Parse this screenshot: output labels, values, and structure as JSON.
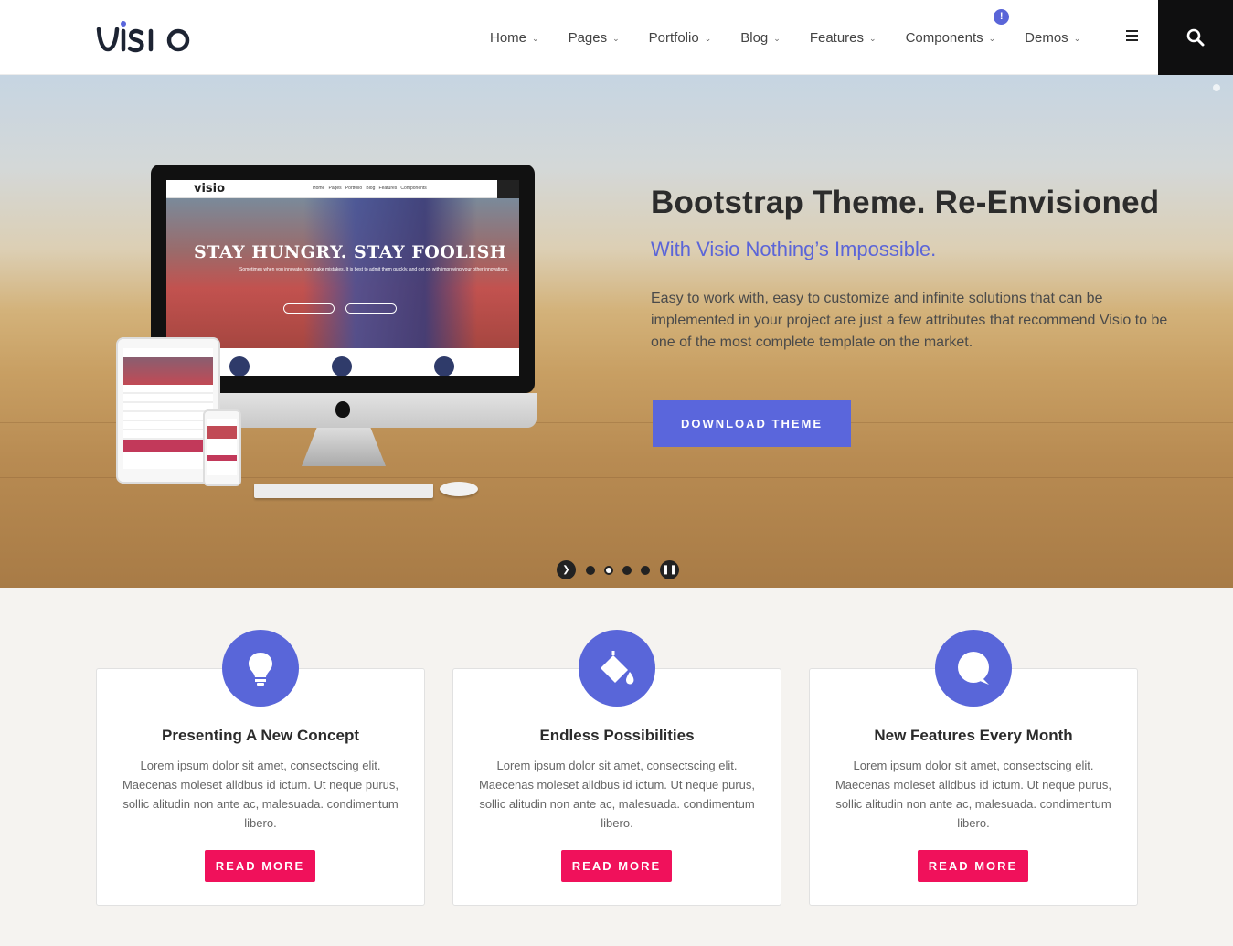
{
  "header": {
    "logo_text": "visio",
    "nav": [
      {
        "label": "Home"
      },
      {
        "label": "Pages"
      },
      {
        "label": "Portfolio"
      },
      {
        "label": "Blog"
      },
      {
        "label": "Features"
      },
      {
        "label": "Components"
      },
      {
        "label": "Demos",
        "badge": "!"
      }
    ],
    "search_icon": "search-icon",
    "menu_icon": "hamburger-icon"
  },
  "hero": {
    "title": "Bootstrap Theme. Re-Envisioned",
    "subtitle": "With Visio Nothing’s Impossible.",
    "description": "Easy to work with, easy to customize and infinite solutions that can be implemented in your project are just a few attributes that recommend Visio to be one of the most complete template on the market.",
    "button": "DOWNLOAD THEME",
    "screen_title": "STAY HUNGRY. STAY FOOLISH",
    "slider": {
      "count": 4,
      "active_index": 1
    }
  },
  "colors": {
    "accent": "#5a66dc",
    "cta": "#f0115b",
    "dark": "#0f0f10"
  },
  "features": [
    {
      "icon": "lightbulb-icon",
      "title": "Presenting A New Concept",
      "text": "Lorem ipsum dolor sit amet, consectscing elit. Maecenas moleset alldbus id ictum. Ut neque purus, sollic alitudin non ante ac, malesuada. condimentum libero.",
      "button": "READ MORE"
    },
    {
      "icon": "paint-bucket-icon",
      "title": "Endless Possibilities",
      "text": "Lorem ipsum dolor sit amet, consectscing elit. Maecenas moleset alldbus id ictum. Ut neque purus, sollic alitudin non ante ac, malesuada. condimentum libero.",
      "button": "READ MORE"
    },
    {
      "icon": "chat-bubble-icon",
      "title": "New Features Every Month",
      "text": "Lorem ipsum dolor sit amet, consectscing elit. Maecenas moleset alldbus id ictum. Ut neque purus, sollic alitudin non ante ac, malesuada. condimentum libero.",
      "button": "READ MORE"
    }
  ]
}
